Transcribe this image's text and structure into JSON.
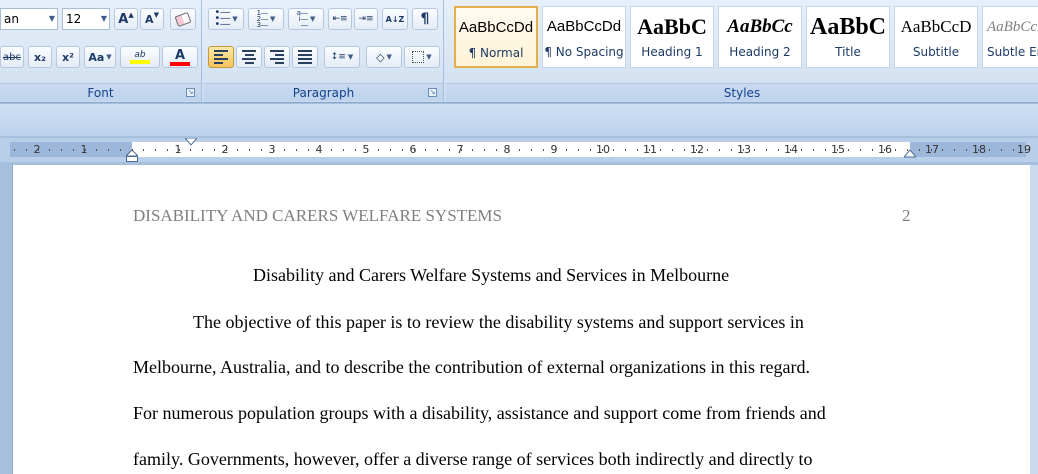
{
  "font_group": {
    "label": "Font",
    "font_name": "an",
    "font_size": "12",
    "grow_font_label": "A",
    "shrink_font_label": "A",
    "strikethrough_label": "abc",
    "subscript_label": "x₂",
    "superscript_label": "x²",
    "change_case_label": "Aa",
    "highlight_label": "ab",
    "font_color_label": "A",
    "highlight_color": "#ffff00",
    "font_color": "#ff0000"
  },
  "paragraph_group": {
    "label": "Paragraph",
    "pilcrow_label": "¶",
    "sort_label": "A↓Z"
  },
  "styles_group": {
    "label": "Styles",
    "items": [
      {
        "sample": "AaBbCcDd",
        "name": "¶ Normal"
      },
      {
        "sample": "AaBbCcDd",
        "name": "¶ No Spacing"
      },
      {
        "sample": "AaBbC",
        "name": "Heading 1"
      },
      {
        "sample": "AaBbCc",
        "name": "Heading 2"
      },
      {
        "sample": "AaBbC",
        "name": "Title"
      },
      {
        "sample": "AaBbCcD",
        "name": "Subtitle"
      },
      {
        "sample": "AaBbCcDd",
        "name": "Subtle Em"
      }
    ]
  },
  "ruler": {
    "left_numbers": [
      "2",
      "1"
    ],
    "right_numbers": [
      "1",
      "2",
      "3",
      "4",
      "5",
      "6",
      "7",
      "8",
      "9",
      "10",
      "11",
      "12",
      "13",
      "14",
      "15",
      "16",
      "17",
      "18",
      "19"
    ]
  },
  "document": {
    "running_head": "DISABILITY AND CARERS WELFARE SYSTEMS",
    "page_number": "2",
    "title": "Disability and Carers Welfare Systems and Services in Melbourne",
    "lines": [
      "The objective of this paper is to review the disability systems and support services in",
      "Melbourne, Australia, and to describe the contribution of external organizations in this regard.",
      "For numerous population groups with a disability, assistance and support come from friends and",
      "family. Governments, however, offer a diverse range of services both indirectly and directly to"
    ]
  },
  "colors": {
    "ribbon_bg": "#dbe7f5",
    "selected_style_border": "#e3b04b",
    "active_button": "#f7c25c",
    "running_head": "#7f7f7f"
  }
}
